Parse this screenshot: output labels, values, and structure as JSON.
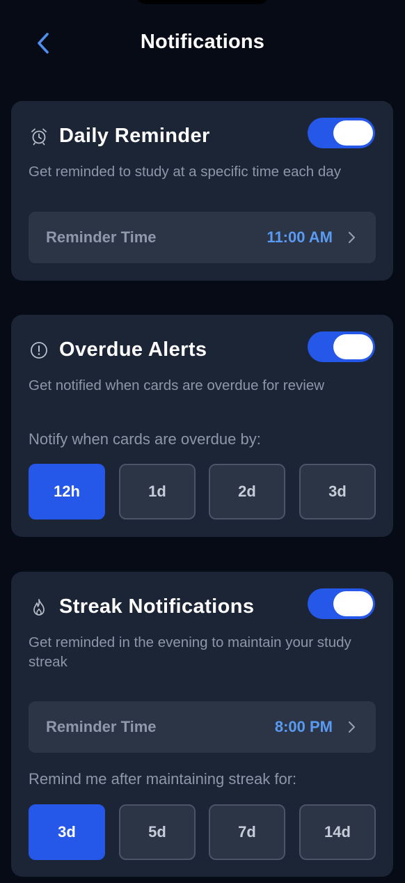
{
  "header": {
    "title": "Notifications",
    "back_icon": "chevron-left-icon"
  },
  "colors": {
    "accent": "#2557e8",
    "value_blue": "#5a9bf1",
    "card_bg": "#1c2536",
    "page_bg": "#070b16"
  },
  "daily_reminder": {
    "icon": "alarm-clock-icon",
    "title": "Daily Reminder",
    "enabled": true,
    "description": "Get reminded to study at a specific time each day",
    "time_label": "Reminder Time",
    "time_value": "11:00 AM"
  },
  "overdue_alerts": {
    "icon": "alert-circle-icon",
    "title": "Overdue Alerts",
    "enabled": true,
    "description": "Get notified when cards are overdue for review",
    "options_label": "Notify when cards are overdue by:",
    "options": [
      "12h",
      "1d",
      "2d",
      "3d"
    ],
    "selected": "12h"
  },
  "streak_notifications": {
    "icon": "flame-icon",
    "title": "Streak Notifications",
    "enabled": true,
    "description": "Get reminded in the evening to maintain your study streak",
    "time_label": "Reminder Time",
    "time_value": "8:00 PM",
    "options_label": "Remind me after maintaining streak for:",
    "options": [
      "3d",
      "5d",
      "7d",
      "14d"
    ],
    "selected": "3d"
  }
}
